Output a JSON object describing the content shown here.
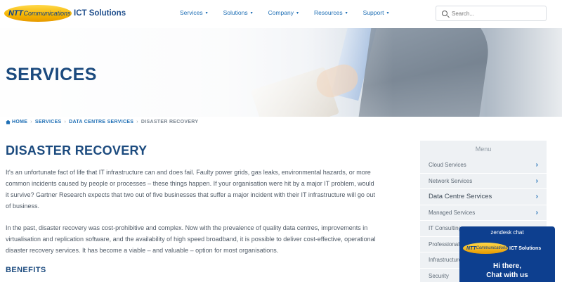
{
  "brand": {
    "logo_ntt": "NTT",
    "logo_comm": "Communications",
    "logo_text": "ICT Solutions"
  },
  "nav": {
    "items": [
      {
        "label": "Services"
      },
      {
        "label": "Solutions"
      },
      {
        "label": "Company"
      },
      {
        "label": "Resources"
      },
      {
        "label": "Support"
      }
    ]
  },
  "search": {
    "placeholder": "Search..."
  },
  "hero": {
    "title": "SERVICES"
  },
  "breadcrumb": {
    "home": "HOME",
    "services": "SERVICES",
    "data_centre": "DATA CENTRE SERVICES",
    "current": "DISASTER RECOVERY"
  },
  "main": {
    "title": "DISASTER RECOVERY",
    "paragraphs": [
      "It's an unfortunate fact of life that IT infrastructure can and does fail. Faulty power grids, gas leaks, environmental hazards, or more common incidents caused by people or processes – these things happen. If your organisation were hit by a major IT problem, would it survive? Gartner Research expects that two out of five businesses that suffer a major incident with their IT infrastructure will go out of business.",
      "In the past, disaster recovery was cost-prohibitive and complex. Now with the prevalence of quality data centres, improvements in virtualisation and replication software, and the availability of high speed broadband, it is possible to deliver cost-effective, operational disaster recovery services. It has become a viable – and valuable – option for most organisations."
    ],
    "benefits_heading": "BENEFITS"
  },
  "sidebar": {
    "title": "Menu",
    "items": [
      {
        "label": "Cloud Services"
      },
      {
        "label": "Network Services"
      },
      {
        "label": "Data Centre Services"
      },
      {
        "label": "Managed Services"
      },
      {
        "label": "IT Consulting"
      },
      {
        "label": "Professional"
      },
      {
        "label": "Infrastructure"
      },
      {
        "label": "Security"
      }
    ]
  },
  "chat": {
    "title": "zendesk chat",
    "logo_ntt": "NTT",
    "logo_comm": "Communications",
    "logo_text": "ICT Solutions",
    "greeting_line1": "Hi there,",
    "greeting_line2": "Chat with us"
  },
  "colors": {
    "brand_blue": "#1b4a7e",
    "link_blue": "#1f6fb5",
    "logo_yellow": "#f5b400",
    "chat_blue": "#0d3f8f"
  }
}
